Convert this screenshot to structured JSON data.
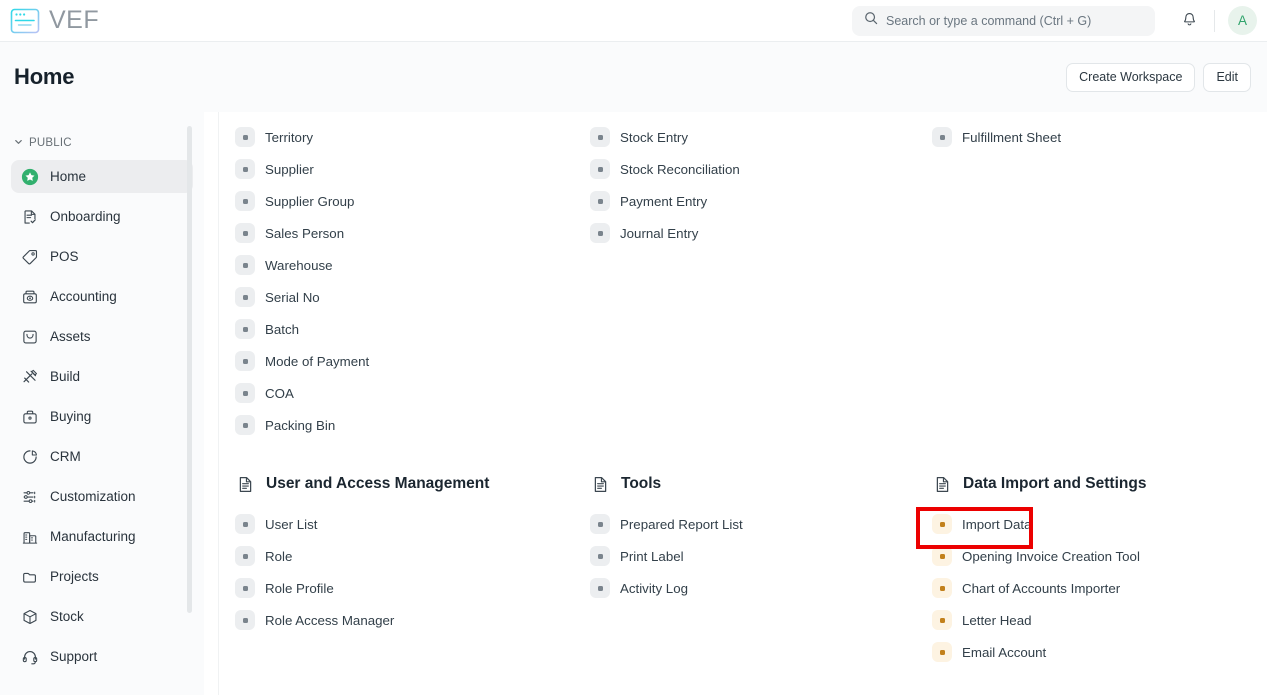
{
  "navbar": {
    "brand_text": "VEF",
    "brand_icon": "browser-window-icon",
    "search": {
      "icon": "search-icon",
      "placeholder": "Search or type a command (Ctrl + G)",
      "value": ""
    },
    "notification_icon": "bell-icon",
    "avatar_initial": "A",
    "avatar_bg": "#e8f3ec",
    "avatar_color": "#31a46c"
  },
  "page_header": {
    "title": "Home",
    "create_workspace_label": "Create Workspace",
    "edit_label": "Edit"
  },
  "sidebar": {
    "section_label": "PUBLIC",
    "chevron_icon": "chevron-down-icon",
    "items": [
      {
        "label": "Home",
        "icon": "star-circle-icon",
        "active": true
      },
      {
        "label": "Onboarding",
        "icon": "document-check-icon",
        "active": false
      },
      {
        "label": "POS",
        "icon": "tag-icon",
        "active": false
      },
      {
        "label": "Accounting",
        "icon": "cash-register-icon",
        "active": false
      },
      {
        "label": "Assets",
        "icon": "box-open-icon",
        "active": false
      },
      {
        "label": "Build",
        "icon": "tools-icon",
        "active": false
      },
      {
        "label": "Buying",
        "icon": "briefcase-icon",
        "active": false
      },
      {
        "label": "CRM",
        "icon": "pie-chart-icon",
        "active": false
      },
      {
        "label": "Customization",
        "icon": "sliders-icon",
        "active": false
      },
      {
        "label": "Manufacturing",
        "icon": "factory-icon",
        "active": false
      },
      {
        "label": "Projects",
        "icon": "folder-icon",
        "active": false
      },
      {
        "label": "Stock",
        "icon": "package-icon",
        "active": false
      },
      {
        "label": "Support",
        "icon": "headset-icon",
        "active": false
      }
    ]
  },
  "main": {
    "top_lists": {
      "col1": [
        "Territory",
        "Supplier",
        "Supplier Group",
        "Sales Person",
        "Warehouse",
        "Serial No",
        "Batch",
        "Mode of Payment",
        "COA",
        "Packing Bin"
      ],
      "col2": [
        "Stock Entry",
        "Stock Reconciliation",
        "Payment Entry",
        "Journal Entry"
      ],
      "col3": [
        "Fulfillment Sheet"
      ]
    },
    "sections": [
      {
        "title": "User and Access Management",
        "icon": "document-lines-icon",
        "bullet_style": "gray",
        "links": [
          "User List",
          "Role",
          "Role Profile",
          "Role Access Manager"
        ]
      },
      {
        "title": "Tools",
        "icon": "document-lines-icon",
        "bullet_style": "gray",
        "links": [
          "Prepared Report List",
          "Print Label",
          "Activity Log"
        ]
      },
      {
        "title": "Data Import and Settings",
        "icon": "document-lines-icon",
        "bullet_style": "warn",
        "links": [
          "Import Data",
          "Opening Invoice Creation Tool",
          "Chart of Accounts Importer",
          "Letter Head",
          "Email Account"
        ]
      }
    ]
  },
  "annotation": {
    "highlight_target": "Import Data",
    "highlight_color": "#ec0000"
  }
}
